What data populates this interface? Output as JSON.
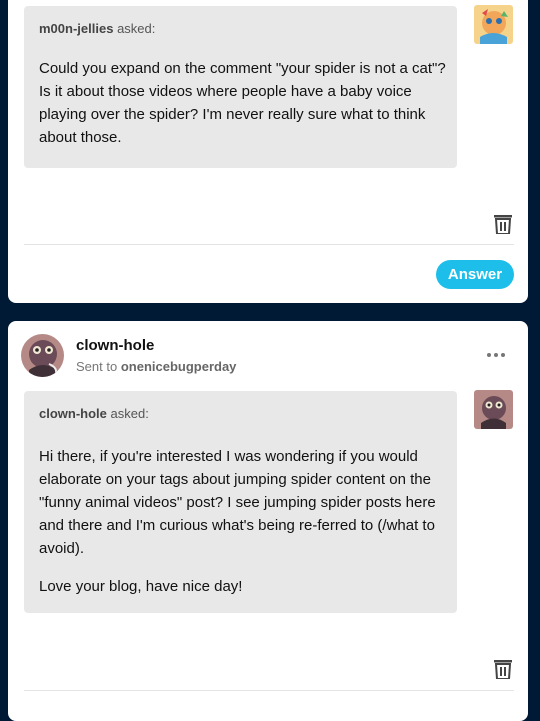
{
  "posts": [
    {
      "asker": "m00n-jellies",
      "asked_suffix": "asked:",
      "message": [
        "Could you expand on the comment \"your spider is not a cat\"? Is it about those videos where people have a baby voice playing over the spider? I'm never really sure what to think about those."
      ],
      "answer_label": "Answer"
    },
    {
      "blog_name": "clown-hole",
      "sent_to_prefix": "Sent to",
      "sent_to_blog": "onenicebugperday",
      "asker": "clown-hole",
      "asked_suffix": "asked:",
      "message": [
        "Hi there, if you're interested I was wondering if you would elaborate on your tags about jumping spider content on the \"funny animal videos\" post? I see jumping spider posts here and there and I'm curious what's being re-ferred to (/what to avoid).",
        "Love your blog, have nice day!"
      ]
    }
  ],
  "icons": {
    "trash": "trash-icon",
    "more": "more-options-icon"
  },
  "colors": {
    "page_bg": "#001935",
    "accent": "#1dbfea",
    "bubble_bg": "#e8e8e8"
  }
}
